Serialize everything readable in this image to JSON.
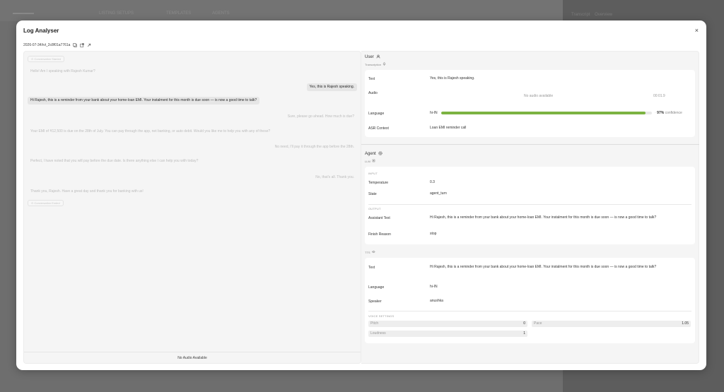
{
  "background": {
    "top_items": [
      "LISTING SETUPS",
      "TEMPLATES",
      "AGENTS"
    ],
    "right_tabs": [
      "Transcript",
      "Overview"
    ]
  },
  "modal": {
    "title": "Log Analyser",
    "close": "×",
    "log_id": "2026-07-34/ivt_2c8f01a7761a"
  },
  "chat": {
    "start_chip": "Conversation Started",
    "end_chip": "Conversation Ended",
    "messages": [
      {
        "side": "left",
        "text": "Hello! Am I speaking with Rajesh Kumar?",
        "state": "faded"
      },
      {
        "side": "right",
        "text": "Yes, this is Rajesh speaking.",
        "state": "active"
      },
      {
        "side": "left",
        "text": "Hi Rajesh, this is a reminder from your bank about your home-loan EMI. Your instalment for this month is due soon — is now a good time to talk?",
        "state": "active"
      },
      {
        "side": "right",
        "text": "Sure, please go ahead. How much is due?",
        "state": "faded"
      },
      {
        "side": "left",
        "text": "Your EMI of ₹12,500 is due on the 28th of July. You can pay through the app, net banking, or auto debit. Would you like me to help you with any of these?",
        "state": "faded"
      },
      {
        "side": "right",
        "text": "No need, I'll pay it through the app before the 28th.",
        "state": "faded"
      },
      {
        "side": "left",
        "text": "Perfect, I have noted that you will pay before the due date. Is there anything else I can help you with today?",
        "state": "faded"
      },
      {
        "side": "right",
        "text": "No, that's all. Thank you.",
        "state": "faded"
      },
      {
        "side": "left",
        "text": "Thank you, Rajesh. Have a great day and thank you for banking with us!",
        "state": "faded"
      }
    ],
    "footer": "No Audio Available"
  },
  "user": {
    "title": "User",
    "subtitle": "Transcription",
    "text_label": "Text",
    "text_value": "Yes, this is Rajesh speaking.",
    "audio_label": "Audio",
    "audio_value": "No audio available",
    "audio_time": "00:01.9",
    "language_label": "Language",
    "language_value": "hi-IN",
    "confidence": 0.97,
    "confidence_pct": "97%",
    "confidence_word": "confidence",
    "asr_label": "ASR Context",
    "asr_value": "Loan EMI reminder call"
  },
  "agent": {
    "title": "Agent",
    "llm_label": "LLM",
    "input_cap": "INPUT",
    "temperature_label": "Temperature",
    "temperature_value": "0.3",
    "state_label": "State",
    "state_value": "agent_turn",
    "output_cap": "OUTPUT",
    "assistant_label": "Assistant Text",
    "assistant_value": "Hi Rajesh, this is a reminder from your bank about your home-loan EMI. Your instalment for this month is due soon — is now a good time to talk?",
    "finish_label": "Finish Reason",
    "finish_value": "stop",
    "tts_label": "TTS",
    "tts_text_label": "Text",
    "tts_text_value": "Hi Rajesh, this is a reminder from your bank about your home-loan EMI. Your instalment for this month is due soon — is now a good time to talk?",
    "tts_language_label": "Language",
    "tts_language_value": "hi-IN",
    "speaker_label": "Speaker",
    "speaker_value": "anushka",
    "voice_cap": "VOICE SETTINGS",
    "pitch_label": "Pitch",
    "pitch_value": "0",
    "pace_label": "Pace",
    "pace_value": "1.05",
    "loudness_label": "Loudness",
    "loudness_value": "1"
  }
}
